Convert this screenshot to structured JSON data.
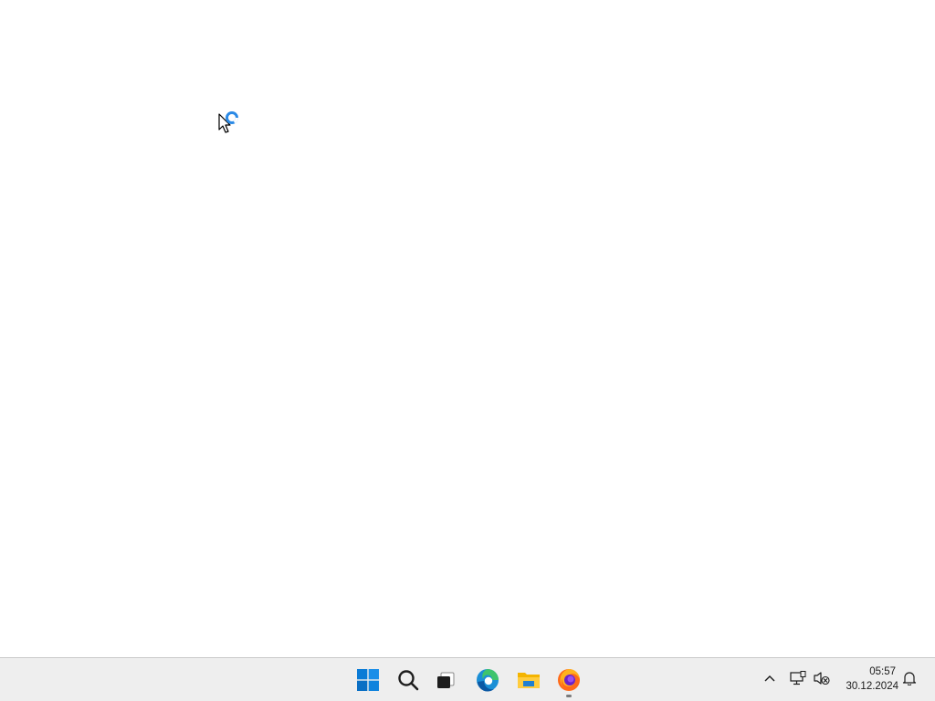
{
  "taskbar": {
    "pinned": [
      {
        "name": "start-button",
        "icon": "windows-start-icon"
      },
      {
        "name": "search-button",
        "icon": "search-icon"
      },
      {
        "name": "task-view-button",
        "icon": "task-view-icon"
      },
      {
        "name": "edge-button",
        "icon": "edge-icon"
      },
      {
        "name": "file-explorer-button",
        "icon": "folder-icon"
      },
      {
        "name": "firefox-button",
        "icon": "firefox-icon",
        "running": true
      }
    ],
    "tray": {
      "overflow_icon": "chevron-up-icon",
      "network_icon": "network-icon",
      "volume_icon": "volume-muted-icon",
      "notification_icon": "bell-icon"
    },
    "clock": {
      "time": "05:57",
      "date": "30.12.2024"
    }
  },
  "colors": {
    "desktop": "#ffffff",
    "taskbar": "#eeeeee",
    "accent": "#0078d4"
  },
  "cursor": {
    "state": "busy",
    "icon": "busy-pointer-icon"
  }
}
